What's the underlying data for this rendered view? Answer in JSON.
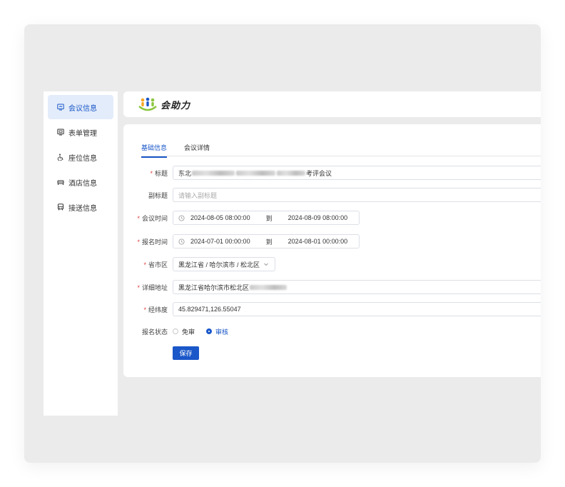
{
  "sidebar": {
    "items": [
      {
        "label": "会议信息",
        "icon": "meeting-icon",
        "active": true
      },
      {
        "label": "表单管理",
        "icon": "form-icon",
        "active": false
      },
      {
        "label": "座位信息",
        "icon": "seat-icon",
        "active": false
      },
      {
        "label": "酒店信息",
        "icon": "hotel-icon",
        "active": false
      },
      {
        "label": "接送信息",
        "icon": "bus-icon",
        "active": false
      }
    ]
  },
  "header": {
    "logo_text": "会助力"
  },
  "tabs": [
    {
      "label": "基础信息",
      "active": true
    },
    {
      "label": "会议详情",
      "active": false
    }
  ],
  "form": {
    "title": {
      "label": "标题",
      "value_prefix": "东北",
      "value_suffix": "考评会议"
    },
    "subtitle": {
      "label": "副标题",
      "placeholder": "请输入副标题"
    },
    "meeting_time": {
      "label": "会议时间",
      "start": "2024-08-05 08:00:00",
      "sep": "到",
      "end": "2024-08-09 08:00:00"
    },
    "signup_time": {
      "label": "报名时间",
      "start": "2024-07-01 00:00:00",
      "sep": "到",
      "end": "2024-08-01 00:00:00"
    },
    "region": {
      "label": "省市区",
      "value": "黑龙江省 / 哈尔滨市 / 松北区"
    },
    "address": {
      "label": "详细地址",
      "value_prefix": "黑龙江省哈尔滨市松北区"
    },
    "coords": {
      "label": "经纬度",
      "value": "45.829471,126.55047"
    },
    "status": {
      "label": "报名状态",
      "options": [
        "免审",
        "审核"
      ],
      "selected": "审核"
    },
    "save_label": "保存"
  },
  "colors": {
    "accent": "#1a57c9",
    "required": "#e04040",
    "background": "#ebebeb"
  }
}
